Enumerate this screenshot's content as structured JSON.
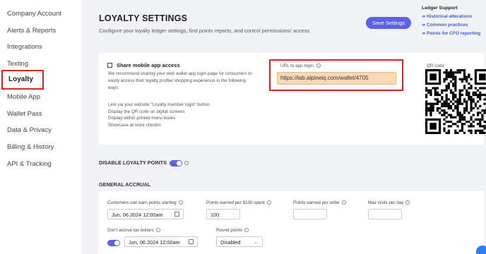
{
  "sidebar": {
    "items": [
      {
        "label": "Company Account"
      },
      {
        "label": "Alerts & Reports"
      },
      {
        "label": "Integrations"
      },
      {
        "label": "Texting"
      },
      {
        "label": "Loyalty",
        "active": true
      },
      {
        "label": "Mobile App"
      },
      {
        "label": "Wallet Pass"
      },
      {
        "label": "Data & Privacy"
      },
      {
        "label": "Billing & History"
      },
      {
        "label": "API & Tracking"
      }
    ]
  },
  "header": {
    "title": "LOYALTY SETTINGS",
    "subtitle": "Configure your loyalty ledger settings, find points reports, and control permissions/ access",
    "save_label": "Save Settings"
  },
  "ledger_support": {
    "title": "Ledger Support",
    "links": [
      "Historical alterations",
      "Common practices",
      "Points for CFO reporting"
    ]
  },
  "share": {
    "heading": "Share mobile app access",
    "description": "We recommend sharing your web wallet app login page for consumers to easily access their loyalty profile/ shopping experience in the following ways:",
    "ways": [
      "Link via your website \"Loyalty member login\" button",
      "Display the QR code on digital screens",
      "Display within printed menu books",
      "Showcase at store checkin"
    ],
    "url_label": "URL to app login:",
    "url_value": "https://lab.alpineiq.com/wallet/4705",
    "qr_label": "QR code:"
  },
  "loyalty_toggle": {
    "label": "DISABLE LOYALTY POINTS",
    "enabled": true
  },
  "accrual": {
    "title": "GENERAL ACCRUAL",
    "start_label": "Customers can earn points starting",
    "start_value": "Jun, 06 2024 12:00am",
    "per100_label": "Points earned per $100 spent",
    "per100_value": "100",
    "per_order_label": "Points earned per order",
    "per_order_value": "",
    "max_visits_label": "Max visits per day",
    "max_visits_value": "",
    "tax_label": "Don't accrue tax dollars",
    "tax_toggle_enabled": true,
    "tax_value": "Jun, 06 2024 12:00am",
    "round_label": "Round points",
    "round_value": "Disabled"
  },
  "colors": {
    "accent": "#5b61e8",
    "highlight": "#d8261c",
    "url_bg": "#fbd9b6",
    "link": "#3b5bdb"
  }
}
